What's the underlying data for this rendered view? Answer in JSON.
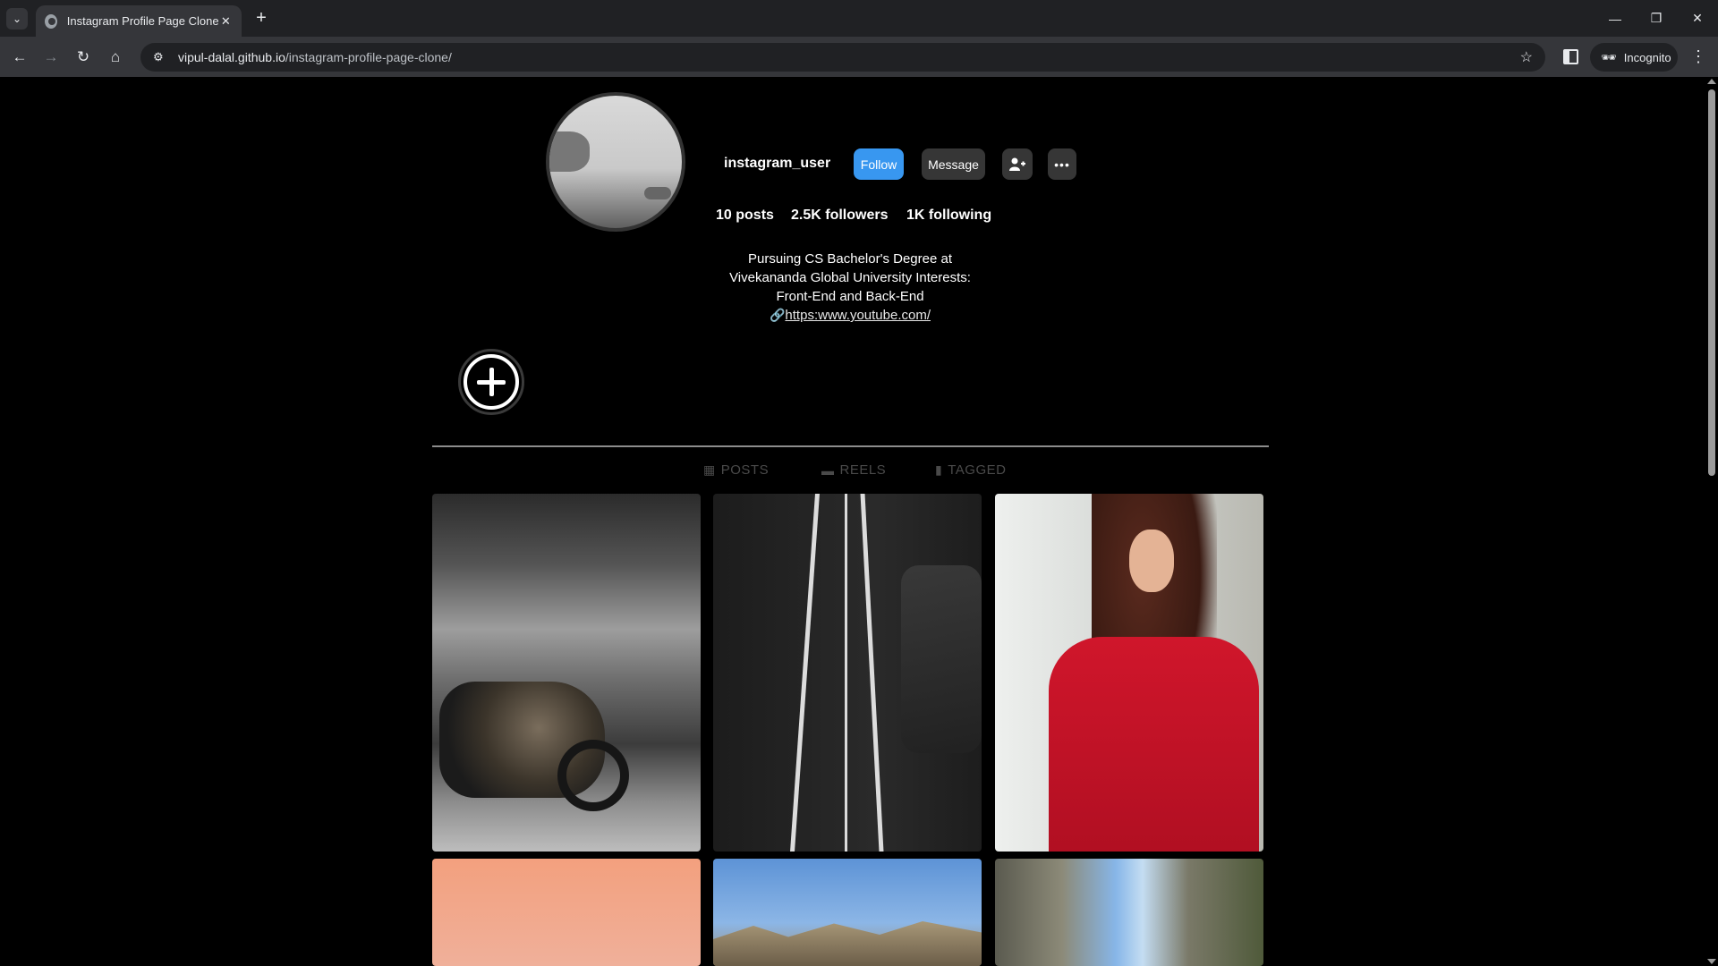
{
  "browser": {
    "tab_title": "Instagram Profile Page Clone",
    "url_domain": "vipul-dalal.github.io",
    "url_path": "/instagram-profile-page-clone/",
    "incognito_label": "Incognito"
  },
  "profile": {
    "username": "instagram_user",
    "follow_label": "Follow",
    "message_label": "Message",
    "stats": {
      "posts": "10 posts",
      "followers": "2.5K followers",
      "following": "1K following"
    },
    "bio_lines": [
      "Pursuing CS Bachelor's Degree at",
      "Vivekananda Global University Interests:",
      "Front-End and Back-End"
    ],
    "link": "https:www.youtube.com/"
  },
  "tabs": [
    {
      "label": "POSTS",
      "icon": "grid-icon"
    },
    {
      "label": "REELS",
      "icon": "clapperboard-icon"
    },
    {
      "label": "TAGGED",
      "icon": "tag-icon"
    }
  ],
  "colors": {
    "accent": "#3897f0",
    "button_dark": "#363636",
    "background": "#000000"
  }
}
